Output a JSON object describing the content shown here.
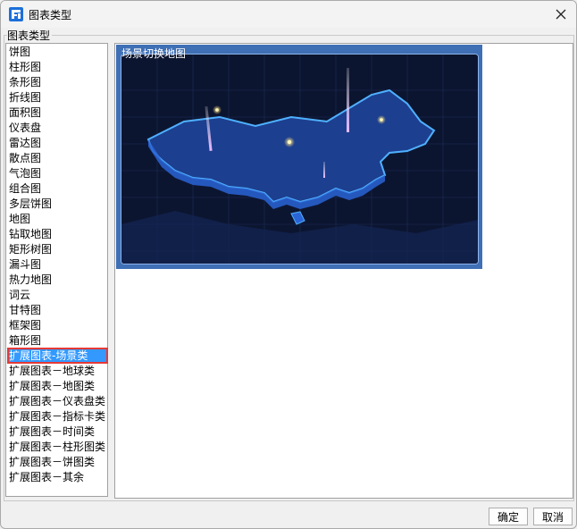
{
  "window": {
    "title": "图表类型"
  },
  "group": {
    "label": "图表类型"
  },
  "chart_types": [
    "饼图",
    "柱形图",
    "条形图",
    "折线图",
    "面积图",
    "仪表盘",
    "雷达图",
    "散点图",
    "气泡图",
    "组合图",
    "多层饼图",
    "地图",
    "钻取地图",
    "矩形树图",
    "漏斗图",
    "热力地图",
    "词云",
    "甘特图",
    "框架图",
    "箱形图",
    "扩展图表-场景类",
    "扩展图表－地球类",
    "扩展图表－地图类",
    "扩展图表－仪表盘类",
    "扩展图表－指标卡类",
    "扩展图表－时间类",
    "扩展图表－柱形图类",
    "扩展图表－饼图类",
    "扩展图表－其余"
  ],
  "selected_index": 20,
  "preview": {
    "thumbnail_title": "场景切换地图"
  },
  "buttons": {
    "ok": "确定",
    "cancel": "取消"
  },
  "colors": {
    "selection": "#3399ff",
    "selection_outline": "#e53935",
    "thumb_bg": "#3f6fb5"
  }
}
